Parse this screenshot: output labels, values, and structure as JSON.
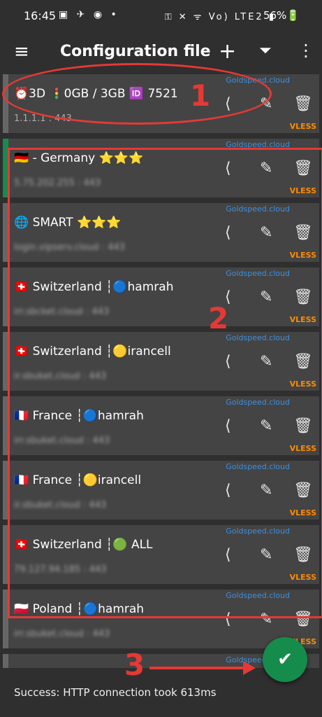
{
  "status": {
    "time": "16:45",
    "left_icons": "▣ ✈ ◉ •",
    "right_icons": "⚿ ✕ ᯤ Vo) LTE2 ▮",
    "battery": "56%🔋"
  },
  "appbar": {
    "title": "Configuration file",
    "menu_icon": "≡",
    "add_icon": "+",
    "filter_icon": "⏷",
    "more_icon": "⋮"
  },
  "actions": {
    "share": "⟨",
    "edit": "✎",
    "delete": "🗑"
  },
  "servers": [
    {
      "title": "⏰3D 🚦0GB / 3GB 🆔 7521",
      "subtitle": "1.1.1.1 : 443",
      "domain": "Goldspeed.cloud",
      "type": "VLESS",
      "selected": false
    },
    {
      "title": "🇩🇪 - Germany ⭐⭐⭐",
      "subtitle": "5.75.202.255 : 443",
      "domain": "Goldspeed.cloud",
      "type": "VLESS",
      "selected": true
    },
    {
      "title": "🌐 SMART ⭐⭐⭐",
      "subtitle": "login.vipserv.cloud : 443",
      "domain": "Goldspeed.cloud",
      "type": "VLESS",
      "selected": false
    },
    {
      "title": "🇨🇭 Switzerland ┆🔵hamrah",
      "subtitle": "irr.sbcket.cloud : 443",
      "domain": "Goldspeed.cloud",
      "type": "VLESS",
      "selected": false
    },
    {
      "title": "🇨🇭 Switzerland ┆🟡irancell",
      "subtitle": "ir.sbuket.cloud : 443",
      "domain": "Goldspeed.cloud",
      "type": "VLESS",
      "selected": false
    },
    {
      "title": "🇫🇷 France ┆🔵hamrah",
      "subtitle": "irr.sbuket.cloud : 443",
      "domain": "Goldspeed.cloud",
      "type": "VLESS",
      "selected": false
    },
    {
      "title": "🇫🇷 France ┆🟡irancell",
      "subtitle": "ir.sbuket.cloud : 443",
      "domain": "Goldspeed.cloud",
      "type": "VLESS",
      "selected": false
    },
    {
      "title": "🇨🇭 Switzerland ┆🟢 ALL",
      "subtitle": "79.127.94.185 : 443",
      "domain": "Goldspeed.cloud",
      "type": "VLESS",
      "selected": false
    },
    {
      "title": "🇵🇱 Poland ┆🔵hamrah",
      "subtitle": "irr.sbuket.cloud : 443",
      "domain": "Goldspeed.cloud",
      "type": "VLESS",
      "selected": false
    },
    {
      "title": "",
      "subtitle": "",
      "domain": "Goldspeed.cloud",
      "type": "",
      "selected": false
    }
  ],
  "fab": {
    "icon": "✔"
  },
  "bottom": {
    "message": "Success: HTTP connection took 613ms"
  },
  "annotations": {
    "one": "1",
    "two": "2",
    "three": "3"
  }
}
